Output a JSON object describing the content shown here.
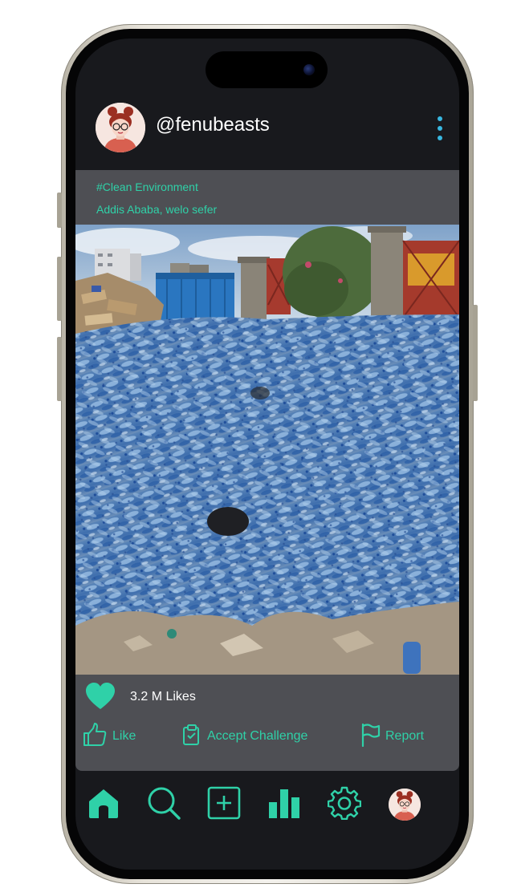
{
  "profile": {
    "username": "@fenubeasts"
  },
  "post": {
    "hashtag": "#Clean Environment",
    "location": "Addis Ababa, welo sefer",
    "likes_count": "3.2 M Likes"
  },
  "actions": {
    "like_label": "Like",
    "accept_challenge_label": "Accept  Challenge",
    "report_label": "Report"
  },
  "nav": {
    "items": [
      "home-icon",
      "search-icon",
      "add-post-icon",
      "stats-icon",
      "settings-icon",
      "profile-avatar"
    ]
  },
  "colors": {
    "accent": "#2fd1a8",
    "kebab": "#38b7e0",
    "background": "#18191d",
    "panel": "#4e4f54"
  }
}
